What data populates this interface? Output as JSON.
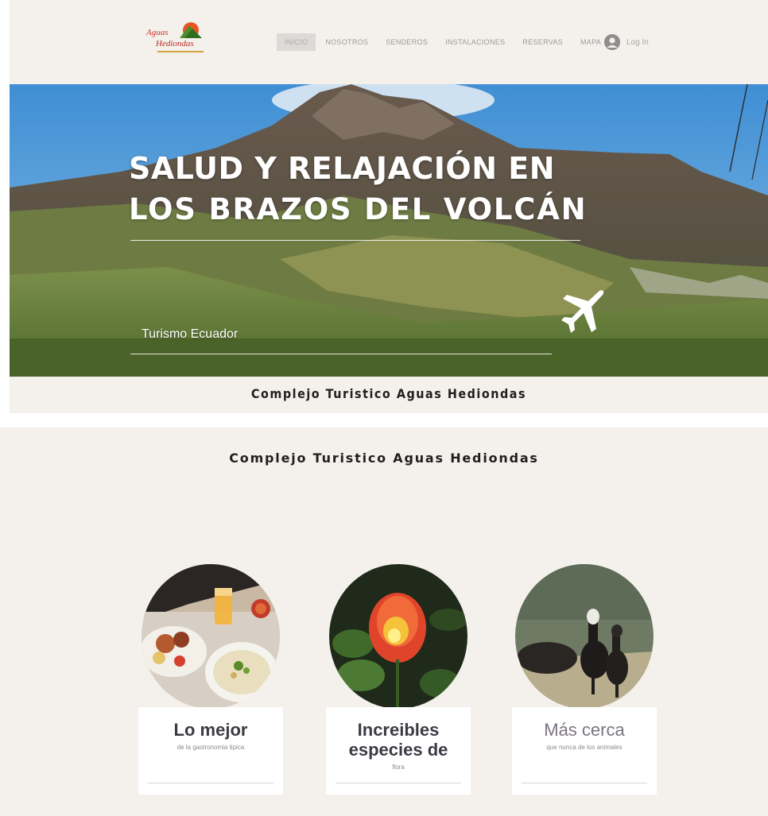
{
  "header": {
    "logo_alt": "Aguas Hediondas",
    "nav": [
      "INICIO",
      "NOSOTROS",
      "SENDEROS",
      "INSTALACIONES",
      "RESERVAS",
      "MAPA"
    ],
    "active_nav": "INICIO",
    "login_label": "Log In"
  },
  "hero": {
    "title_line1": "SALUD Y RELAJACIÓN EN",
    "title_line2": "LOS BRAZOS DEL VOLCÁN",
    "subtitle": "Turismo Ecuador"
  },
  "strip": {
    "title": "Complejo Turistico Aguas Hediondas"
  },
  "section": {
    "title": "Complejo Turistico Aguas Hediondas"
  },
  "cards": [
    {
      "heading": "Lo mejor",
      "sub": "de la gastronomia tipica"
    },
    {
      "heading_line1": "Increibles",
      "heading_line2": "especies de",
      "sub": "flora"
    },
    {
      "heading": "Más cerca",
      "sub": "que nunca de los animales"
    }
  ],
  "colors": {
    "page_bg": "#f4f1ec",
    "nav_active_bg": "#dcdad6",
    "title_text": "#1f1f1f",
    "card_bg": "#ffffff"
  }
}
